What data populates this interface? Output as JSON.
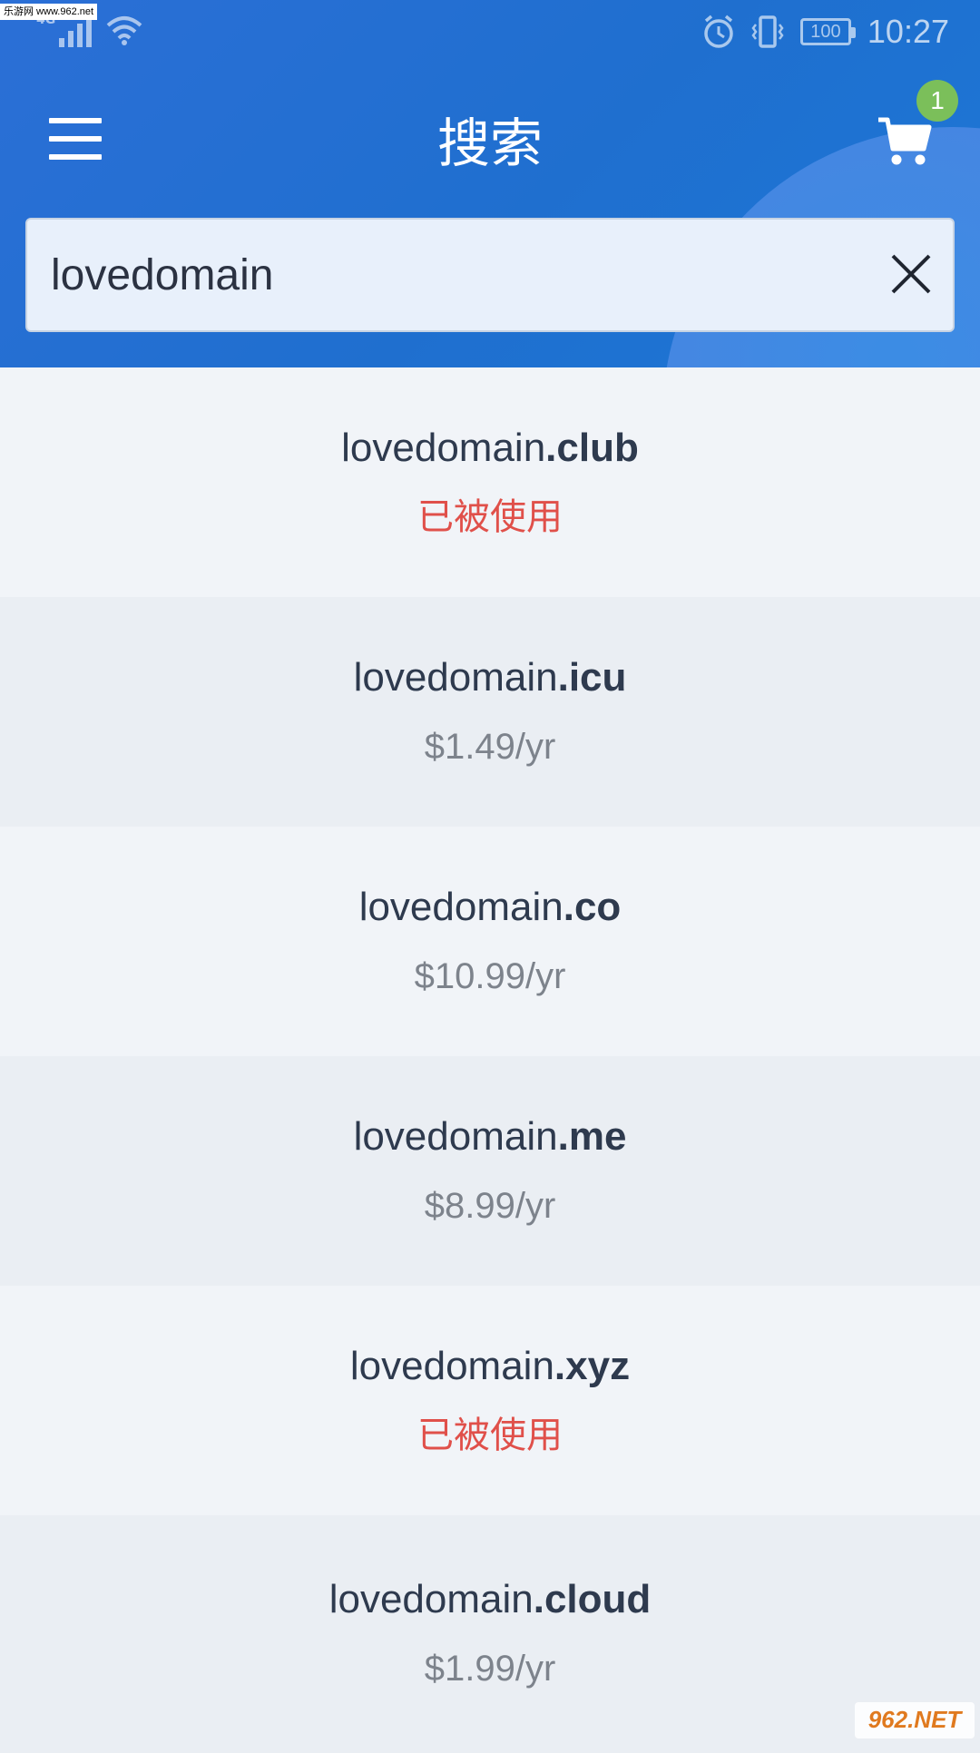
{
  "status_bar": {
    "watermark": "乐游网 www.962.net",
    "network": "4G",
    "battery": "100",
    "time": "10:27"
  },
  "header": {
    "title": "搜索",
    "cart_count": "1"
  },
  "search": {
    "value": "lovedomain",
    "placeholder": ""
  },
  "results": [
    {
      "name": "lovedomain",
      "tld": ".club",
      "status": "已被使用",
      "taken": true
    },
    {
      "name": "lovedomain",
      "tld": ".icu",
      "status": "$1.49/yr",
      "taken": false
    },
    {
      "name": "lovedomain",
      "tld": ".co",
      "status": "$10.99/yr",
      "taken": false
    },
    {
      "name": "lovedomain",
      "tld": ".me",
      "status": "$8.99/yr",
      "taken": false
    },
    {
      "name": "lovedomain",
      "tld": ".xyz",
      "status": "已被使用",
      "taken": true
    },
    {
      "name": "lovedomain",
      "tld": ".cloud",
      "status": "$1.99/yr",
      "taken": false
    }
  ],
  "footer": {
    "watermark": "962.NET"
  },
  "colors": {
    "header_blue": "#1f6fcf",
    "taken_red": "#e0504a",
    "price_gray": "#7d838c",
    "badge_green": "#7bbf5a"
  },
  "icons": {
    "menu": "hamburger-menu-icon",
    "cart": "shopping-cart-icon",
    "clear": "close-icon"
  }
}
